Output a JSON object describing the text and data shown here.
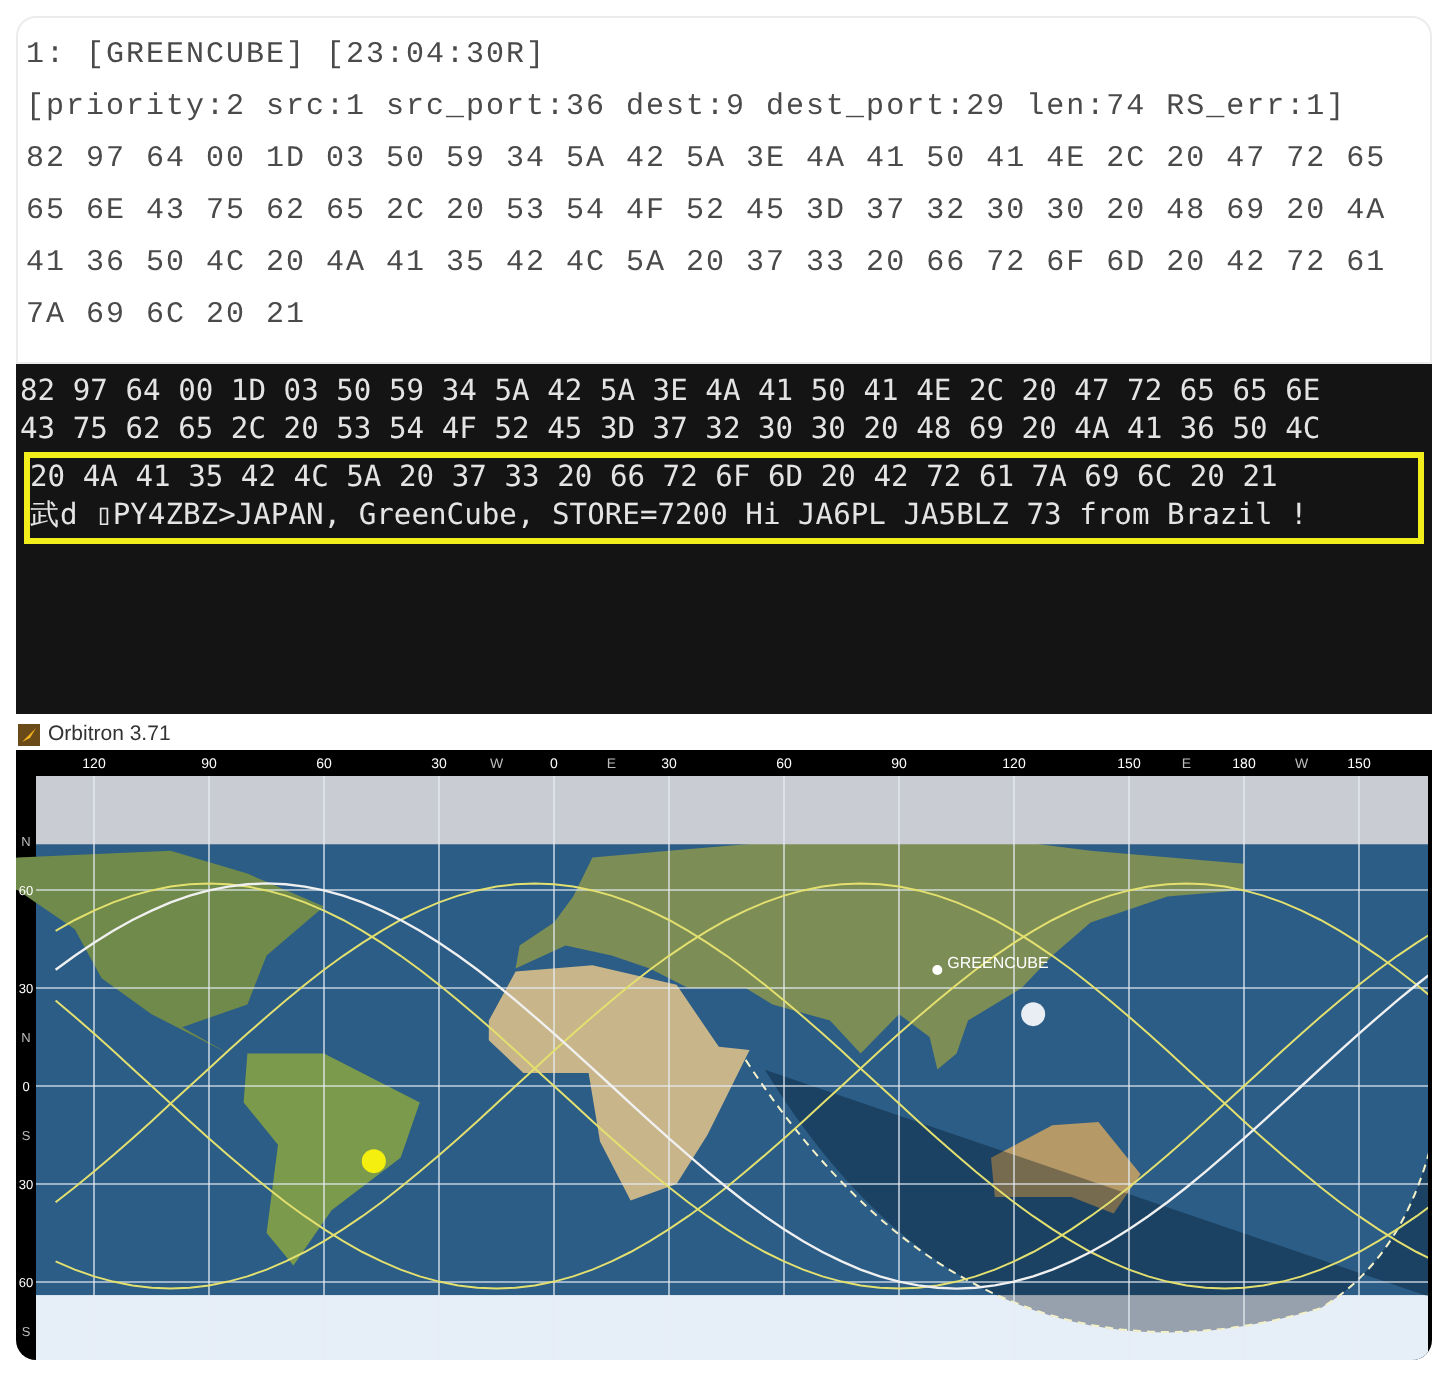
{
  "log_panel": {
    "lines": [
      "1: [GREENCUBE] [23:04:30R]",
      "[priority:2 src:1 src_port:36 dest:9 dest_port:29 len:74 RS_err:1]",
      "82 97 64 00 1D 03 50 59 34 5A 42 5A 3E 4A 41 50 41 4E 2C 20 47 72 65",
      "65 6E 43 75 62 65 2C 20 53 54 4F 52 45 3D 37 32 30 30 20 48 69 20 4A",
      "41 36 50 4C 20 4A 41 35 42 4C 5A 20 37 33 20 66 72 6F 6D 20 42 72 61",
      "7A 69 6C 20 21"
    ]
  },
  "terminal": {
    "lines": [
      {
        "text": "82 97 64 00 1D 03 50 59 34 5A 42 5A 3E 4A 41 50 41 4E 2C 20 47 72 65 65 6E",
        "highlighted": false
      },
      {
        "text": "43 75 62 65 2C 20 53 54 4F 52 45 3D 37 32 30 30 20 48 69 20 4A 41 36 50 4C",
        "highlighted": false
      },
      {
        "text": "20 4A 41 35 42 4C 5A 20 37 33 20 66 72 6F 6D 20 42 72 61 7A 69 6C 20 21",
        "highlighted": true
      },
      {
        "text": "武d ▯PY4ZBZ>JAPAN, GreenCube, STORE=7200 Hi JA6PL JA5BLZ 73 from Brazil !",
        "highlighted": true
      }
    ]
  },
  "orbitron": {
    "title": "Orbitron 3.71",
    "top_axis": [
      {
        "label": "120",
        "kind": "degree"
      },
      {
        "label": "90",
        "kind": "degree"
      },
      {
        "label": "60",
        "kind": "degree"
      },
      {
        "label": "30",
        "kind": "degree"
      },
      {
        "label": "W",
        "kind": "hemisphere"
      },
      {
        "label": "0",
        "kind": "degree"
      },
      {
        "label": "E",
        "kind": "hemisphere"
      },
      {
        "label": "30",
        "kind": "degree"
      },
      {
        "label": "60",
        "kind": "degree"
      },
      {
        "label": "90",
        "kind": "degree"
      },
      {
        "label": "120",
        "kind": "degree"
      },
      {
        "label": "150",
        "kind": "degree"
      },
      {
        "label": "E",
        "kind": "hemisphere"
      },
      {
        "label": "180",
        "kind": "degree"
      },
      {
        "label": "W",
        "kind": "hemisphere"
      },
      {
        "label": "150",
        "kind": "degree"
      }
    ],
    "left_axis": [
      {
        "label": "N",
        "kind": "hemisphere"
      },
      {
        "label": "60",
        "kind": "degree"
      },
      {
        "label": "30",
        "kind": "degree"
      },
      {
        "label": "N",
        "kind": "hemisphere"
      },
      {
        "label": "0",
        "kind": "degree"
      },
      {
        "label": "S",
        "kind": "hemisphere"
      },
      {
        "label": "30",
        "kind": "degree"
      },
      {
        "label": "60",
        "kind": "degree"
      },
      {
        "label": "S",
        "kind": "hemisphere"
      }
    ],
    "satellite_label": "GREENCUBE"
  }
}
